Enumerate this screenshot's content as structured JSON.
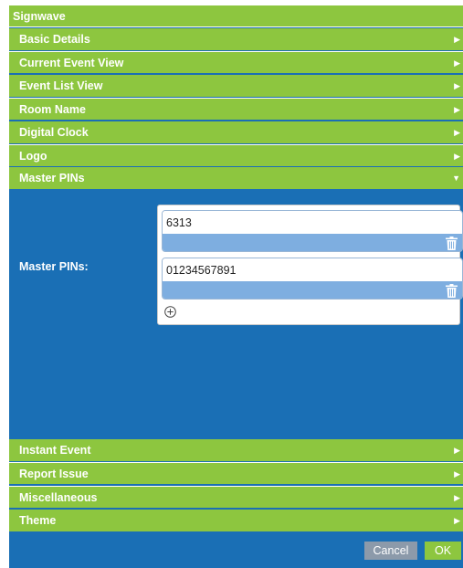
{
  "window": {
    "title": "Signwave"
  },
  "sections": {
    "basic_details": "Basic Details",
    "current_event_view": "Current Event View",
    "event_list_view": "Event List View",
    "room_name": "Room Name",
    "digital_clock": "Digital Clock",
    "logo": "Logo",
    "master_pins": "Master PINs",
    "instant_event": "Instant Event",
    "report_issue": "Report Issue",
    "miscellaneous": "Miscellaneous",
    "theme": "Theme"
  },
  "arrows": {
    "collapsed": "▶",
    "expanded": "▼"
  },
  "master_pins_panel": {
    "label": "Master PINs:",
    "pins": [
      "6313",
      "01234567891"
    ]
  },
  "footer": {
    "cancel_label": "Cancel",
    "ok_label": "OK"
  },
  "colors": {
    "header_green": "#8dc63f",
    "panel_blue": "#1a6fb5",
    "pin_bar_blue": "#7eaee0",
    "cancel_gray": "#8c9aaa"
  },
  "icons": {
    "trash": "trash-icon",
    "add": "add-circle-icon",
    "collapsed_arrow": "triangle-right-icon",
    "expanded_arrow": "triangle-down-icon"
  }
}
